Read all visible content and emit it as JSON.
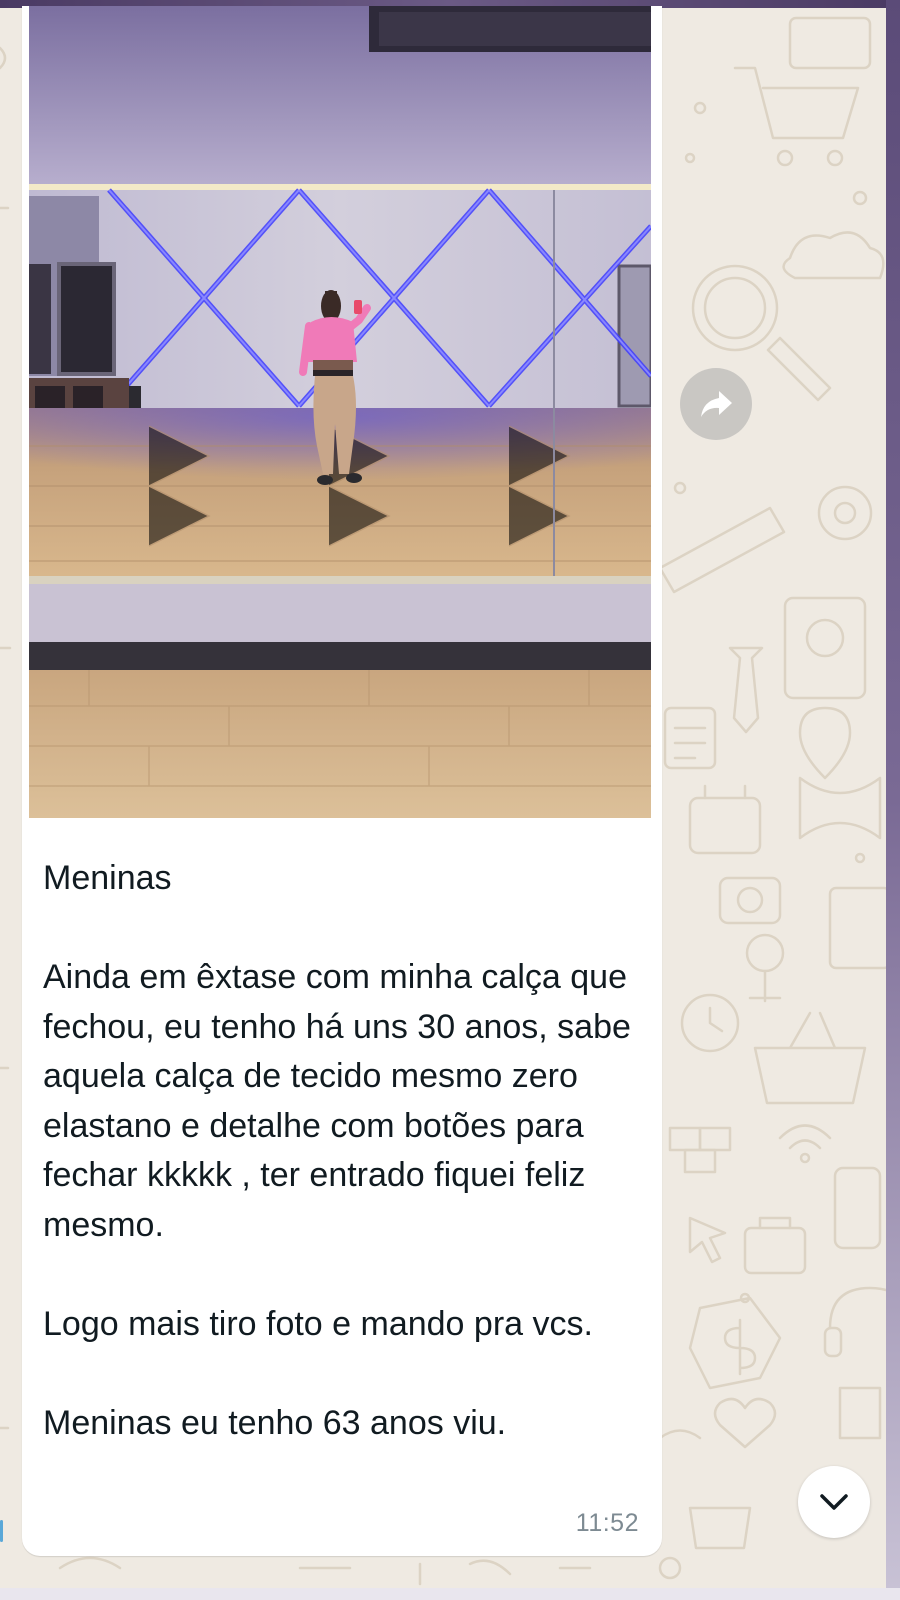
{
  "message": {
    "paragraphs": [
      "Meninas",
      "Ainda em êxtase com minha calça que fechou, eu tenho há uns 30 anos, sabe aquela calça de tecido mesmo zero elastano e detalhe com botões para fechar kkkkk , ter entrado fiquei feliz mesmo.",
      "Logo mais tiro foto e mando pra vcs.",
      "Meninas eu tenho 63 anos viu."
    ],
    "time": "11:52"
  },
  "icons": {
    "forward": "forward-arrow-icon",
    "scroll_down": "chevron-down-icon"
  },
  "colors": {
    "chat_background": "#efeae2",
    "bubble": "#ffffff",
    "text": "#111b21",
    "timestamp": "#7d8a92"
  }
}
